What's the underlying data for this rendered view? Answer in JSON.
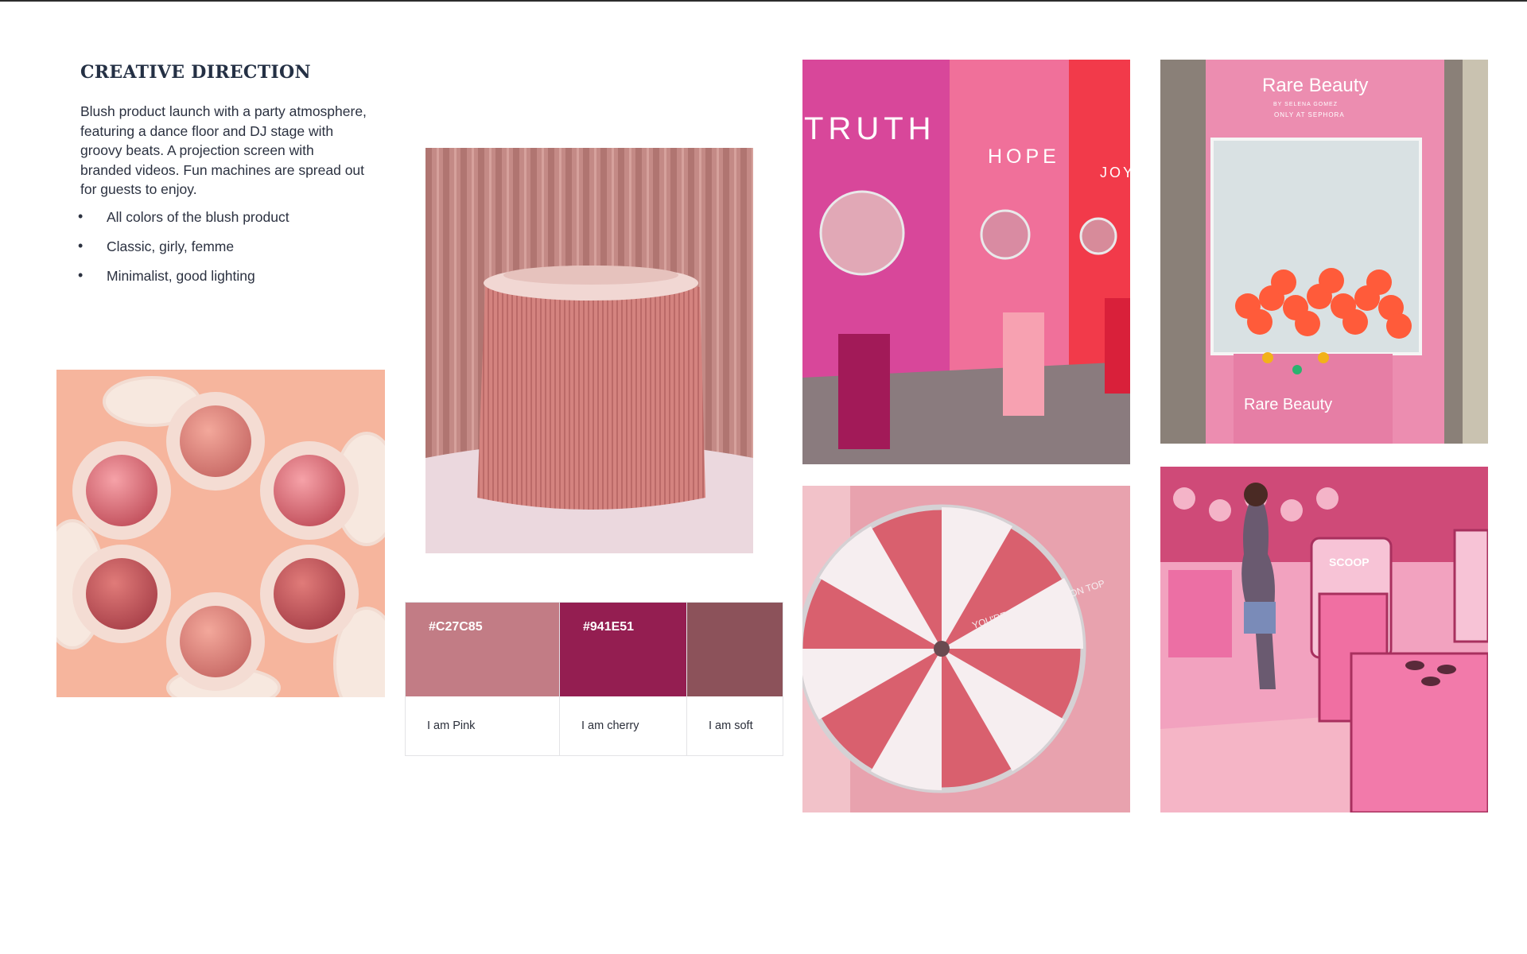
{
  "page": {
    "heading": "CREATIVE DIRECTION",
    "description": "Blush product launch with a party atmosphere, featuring a dance floor and DJ stage with groovy beats. A projection screen with branded videos. Fun machines are spread out for guests to enjoy.",
    "bullets": [
      "All colors of the blush product",
      "Classic, girly, femme",
      "Minimalist, good lighting"
    ]
  },
  "palette": [
    {
      "hex": "#C27C85",
      "label": "#C27C85",
      "name": "I am Pink"
    },
    {
      "hex": "#941E51",
      "label": "#941E51",
      "name": "I am cherry"
    },
    {
      "hex": "#8C525A",
      "label": "",
      "name": "I am soft"
    }
  ],
  "photos": {
    "wall_words": [
      "TRUTH",
      "HOPE",
      "JOY"
    ],
    "claw_brand": "Rare Beauty",
    "claw_sub": "BY SELENA GOMEZ",
    "claw_store": "ONLY AT SEPHORA",
    "claw_panel": "Rare Beauty",
    "wheel_text": "YOU'RE THE CHERRY ON TOP",
    "scoop_sign": "SCOOP"
  }
}
